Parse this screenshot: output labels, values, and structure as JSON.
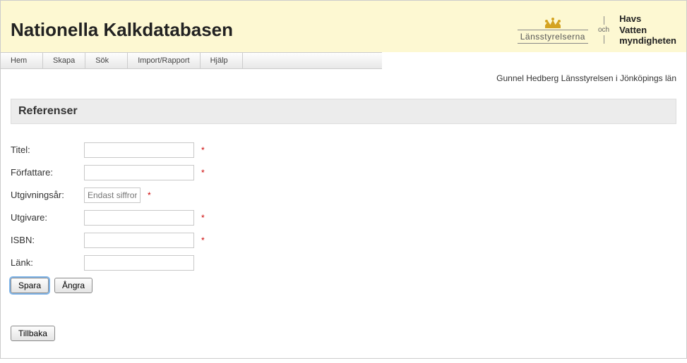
{
  "header": {
    "title": "Nationella Kalkdatabasen",
    "logo1_text": "Länsstyrelserna",
    "logo_sep": "och",
    "logo2_line1": "Havs",
    "logo2_line2": "Vatten",
    "logo2_line3": "myndigheten"
  },
  "nav": {
    "items": [
      "Hem",
      "Skapa",
      "Sök",
      "Import/Rapport",
      "Hjälp"
    ]
  },
  "user_line": "Gunnel Hedberg Länsstyrelsen i Jönköpings län",
  "section": {
    "title": "Referenser"
  },
  "form": {
    "titel": {
      "label": "Titel:",
      "value": "",
      "placeholder": "",
      "required": true
    },
    "forfattare": {
      "label": "Författare:",
      "value": "",
      "placeholder": "",
      "required": true
    },
    "utgivningsar": {
      "label": "Utgivningsår:",
      "value": "",
      "placeholder": "Endast siffror",
      "required": true
    },
    "utgivare": {
      "label": "Utgivare:",
      "value": "",
      "placeholder": "",
      "required": true
    },
    "isbn": {
      "label": "ISBN:",
      "value": "",
      "placeholder": "",
      "required": true
    },
    "lank": {
      "label": "Länk:",
      "value": "",
      "placeholder": "",
      "required": false
    }
  },
  "buttons": {
    "save": "Spara",
    "undo": "Ångra",
    "back": "Tillbaka"
  },
  "required_mark": "*"
}
